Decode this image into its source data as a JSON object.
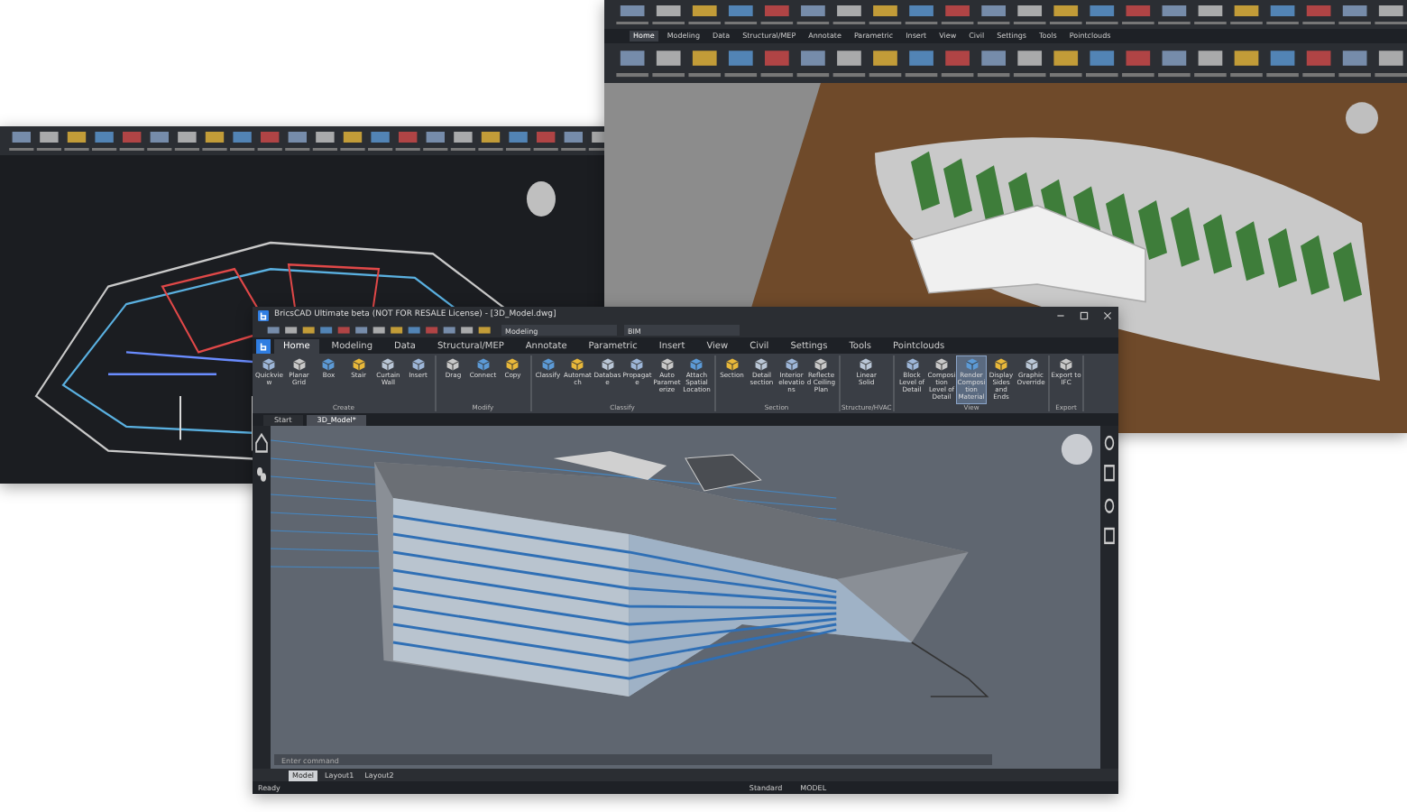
{
  "back_windows": [
    {
      "kind": "floor-plan"
    },
    {
      "kind": "site-model",
      "tabs": [
        {
          "label": "Home",
          "selected": true
        },
        {
          "label": "Modeling",
          "selected": false
        },
        {
          "label": "Data",
          "selected": false
        },
        {
          "label": "Structural/MEP",
          "selected": false
        },
        {
          "label": "Annotate",
          "selected": false
        },
        {
          "label": "Parametric",
          "selected": false
        },
        {
          "label": "Insert",
          "selected": false
        },
        {
          "label": "View",
          "selected": false
        },
        {
          "label": "Civil",
          "selected": false
        },
        {
          "label": "Settings",
          "selected": false
        },
        {
          "label": "Tools",
          "selected": false
        },
        {
          "label": "Pointclouds",
          "selected": false
        }
      ]
    }
  ],
  "main_window": {
    "title": "BricsCAD Ultimate beta (NOT FOR RESALE License) - [3D_Model.dwg]",
    "workspace": "Modeling",
    "layer": "BIM",
    "tabs": [
      {
        "label": "Home",
        "selected": true
      },
      {
        "label": "Modeling",
        "selected": false
      },
      {
        "label": "Data",
        "selected": false
      },
      {
        "label": "Structural/MEP",
        "selected": false
      },
      {
        "label": "Annotate",
        "selected": false
      },
      {
        "label": "Parametric",
        "selected": false
      },
      {
        "label": "Insert",
        "selected": false
      },
      {
        "label": "View",
        "selected": false
      },
      {
        "label": "Civil",
        "selected": false
      },
      {
        "label": "Settings",
        "selected": false
      },
      {
        "label": "Tools",
        "selected": false
      },
      {
        "label": "Pointclouds",
        "selected": false
      }
    ],
    "ribbon_groups": [
      {
        "label": "Create",
        "buttons": [
          {
            "label": "Quickview",
            "selected": false
          },
          {
            "label": "Planar Grid",
            "selected": false
          },
          {
            "label": "Box",
            "selected": false
          },
          {
            "label": "Stair",
            "selected": false
          },
          {
            "label": "Curtain Wall",
            "selected": false
          },
          {
            "label": "Insert",
            "selected": false
          }
        ]
      },
      {
        "label": "Modify",
        "buttons": [
          {
            "label": "Drag",
            "selected": false
          },
          {
            "label": "Connect",
            "selected": false
          },
          {
            "label": "Copy",
            "selected": false
          }
        ]
      },
      {
        "label": "Classify",
        "buttons": [
          {
            "label": "Classify",
            "selected": false
          },
          {
            "label": "Automatch",
            "selected": false
          },
          {
            "label": "Database",
            "selected": false
          },
          {
            "label": "Propagate",
            "selected": false
          },
          {
            "label": "Auto Parameterize",
            "selected": false
          },
          {
            "label": "Attach Spatial Location",
            "selected": false
          }
        ]
      },
      {
        "label": "Section",
        "buttons": [
          {
            "label": "Section",
            "selected": false
          },
          {
            "label": "Detail section",
            "selected": false
          },
          {
            "label": "Interior elevations",
            "selected": false
          },
          {
            "label": "Reflected Ceiling Plan",
            "selected": false
          }
        ]
      },
      {
        "label": "Structure/HVAC",
        "buttons": [
          {
            "label": "Linear Solid",
            "selected": false
          }
        ]
      },
      {
        "label": "View",
        "buttons": [
          {
            "label": "Block Level of Detail",
            "selected": false
          },
          {
            "label": "Composition Level of Detail",
            "selected": false
          },
          {
            "label": "Render Composition Material",
            "selected": true
          },
          {
            "label": "Display Sides and Ends",
            "selected": false
          },
          {
            "label": "Graphic Override",
            "selected": false
          }
        ]
      },
      {
        "label": "Export",
        "buttons": [
          {
            "label": "Export to IFC",
            "selected": false
          }
        ]
      }
    ],
    "doc_tabs": [
      {
        "label": "Start",
        "selected": false
      },
      {
        "label": "3D_Model*",
        "selected": true
      }
    ],
    "command_placeholder": "Enter command",
    "layout_tabs": [
      {
        "label": "Model",
        "selected": true
      },
      {
        "label": "Layout1",
        "selected": false
      },
      {
        "label": "Layout2",
        "selected": false
      }
    ],
    "status_bar": [
      "Ready",
      "Standard",
      "MODEL"
    ]
  }
}
